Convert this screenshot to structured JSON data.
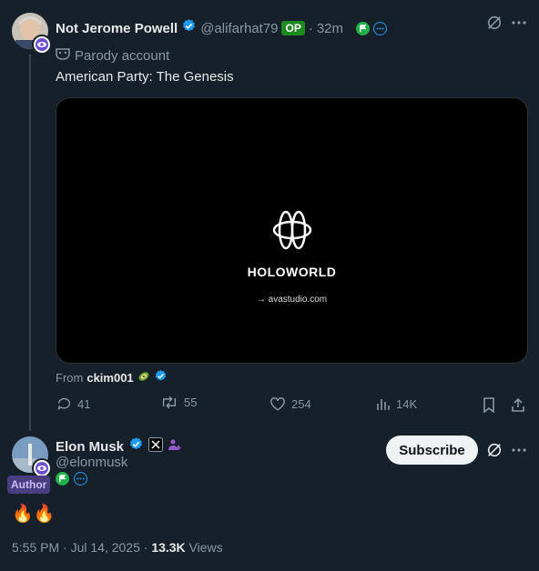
{
  "colors": {
    "background": "#15202b",
    "verified": "#1d9bf0",
    "op_badge": "#1d8a1d",
    "author_tag": "#4a3e80"
  },
  "post": {
    "author_name": "Not Jerome Powell",
    "handle": "@alifarhat79",
    "op_label": "OP",
    "separator": "·",
    "time": "32m",
    "parody_label": "Parody account",
    "text": "American Party: The Genesis",
    "media": {
      "brand": "HOLOWORLD",
      "link_text": "→ avastudio.com"
    },
    "from_prefix": "From",
    "from_account": "ckim001",
    "actions": {
      "replies": "41",
      "reposts": "55",
      "likes": "254",
      "views": "14K"
    }
  },
  "reply": {
    "author_name": "Elon Musk",
    "handle": "@elonmusk",
    "author_tag": "Author",
    "subscribe_label": "Subscribe",
    "text": "🔥🔥",
    "timestamp": "5:55 PM · Jul 14, 2025 · ",
    "views_count": "13.3K",
    "views_label": " Views"
  }
}
